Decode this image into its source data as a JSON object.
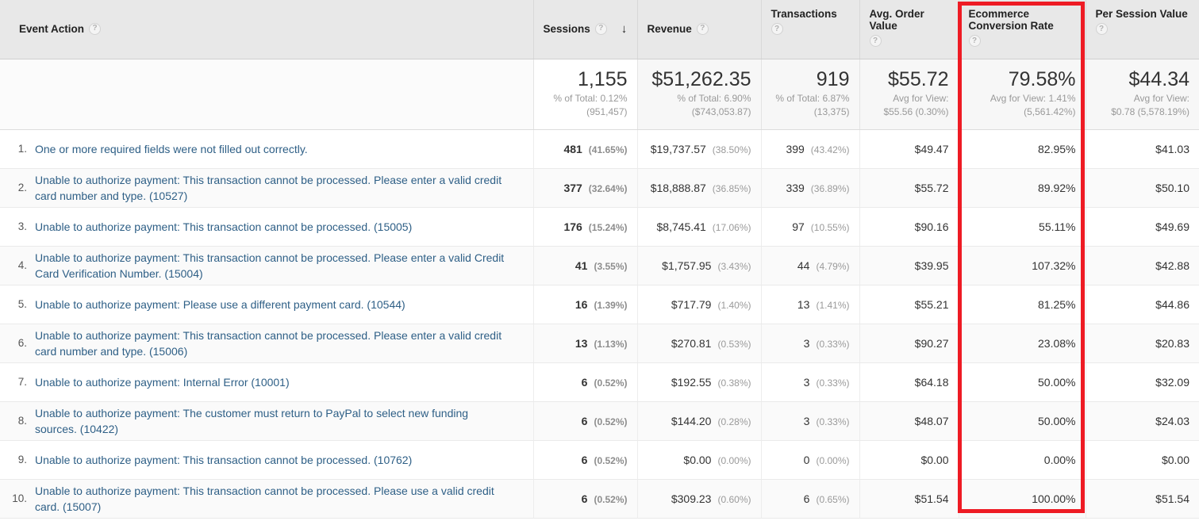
{
  "table": {
    "columns": [
      {
        "id": "event_action",
        "label": "Event Action",
        "help": "?",
        "align": "left",
        "sorted": false
      },
      {
        "id": "sessions",
        "label": "Sessions",
        "help": "?",
        "align": "right",
        "sorted": true,
        "sort_arrow": "↓"
      },
      {
        "id": "revenue",
        "label": "Revenue",
        "help": "?",
        "align": "right",
        "sorted": false
      },
      {
        "id": "transactions",
        "label": "Transactions",
        "help": "?",
        "align": "right",
        "sorted": false
      },
      {
        "id": "avg_order_value",
        "label": "Avg. Order Value",
        "help": "?",
        "align": "right",
        "sorted": false
      },
      {
        "id": "ecommerce_conversion_rate",
        "label": "Ecommerce Conversion Rate",
        "help": "?",
        "align": "right",
        "sorted": false,
        "highlighted": true
      },
      {
        "id": "per_session_value",
        "label": "Per Session Value",
        "help": "?",
        "align": "right",
        "sorted": false
      }
    ],
    "summary": {
      "sessions": {
        "value": "1,155",
        "line1": "% of Total: 0.12%",
        "line2": "(951,457)"
      },
      "revenue": {
        "value": "$51,262.35",
        "line1": "% of Total: 6.90%",
        "line2": "($743,053.87)"
      },
      "transactions": {
        "value": "919",
        "line1": "% of Total: 6.87%",
        "line2": "(13,375)"
      },
      "avg_order": {
        "value": "$55.72",
        "line1": "Avg for View:",
        "line2": "$55.56 (0.30%)"
      },
      "ecr": {
        "value": "79.58%",
        "line1": "Avg for View: 1.41%",
        "line2": "(5,561.42%)"
      },
      "psv": {
        "value": "$44.34",
        "line1": "Avg for View:",
        "line2": "$0.78 (5,578.19%)"
      }
    },
    "rows": [
      {
        "index": "1.",
        "label": "One or more required fields were not filled out correctly.",
        "lines": 1,
        "sessions": "481",
        "sessions_pct": "(41.65%)",
        "revenue": "$19,737.57",
        "revenue_pct": "(38.50%)",
        "transactions": "399",
        "transactions_pct": "(43.42%)",
        "avg_order": "$49.47",
        "ecr": "82.95%",
        "psv": "$41.03"
      },
      {
        "index": "2.",
        "label": "Unable to authorize payment: This transaction cannot be processed. Please enter a valid credit card number and type. (10527)",
        "lines": 2,
        "sessions": "377",
        "sessions_pct": "(32.64%)",
        "revenue": "$18,888.87",
        "revenue_pct": "(36.85%)",
        "transactions": "339",
        "transactions_pct": "(36.89%)",
        "avg_order": "$55.72",
        "ecr": "89.92%",
        "psv": "$50.10"
      },
      {
        "index": "3.",
        "label": "Unable to authorize payment: This transaction cannot be processed. (15005)",
        "lines": 1,
        "sessions": "176",
        "sessions_pct": "(15.24%)",
        "revenue": "$8,745.41",
        "revenue_pct": "(17.06%)",
        "transactions": "97",
        "transactions_pct": "(10.55%)",
        "avg_order": "$90.16",
        "ecr": "55.11%",
        "psv": "$49.69"
      },
      {
        "index": "4.",
        "label": "Unable to authorize payment: This transaction cannot be processed. Please enter a valid Credit Card Verification Number. (15004)",
        "lines": 2,
        "sessions": "41",
        "sessions_pct": "(3.55%)",
        "revenue": "$1,757.95",
        "revenue_pct": "(3.43%)",
        "transactions": "44",
        "transactions_pct": "(4.79%)",
        "avg_order": "$39.95",
        "ecr": "107.32%",
        "psv": "$42.88"
      },
      {
        "index": "5.",
        "label": "Unable to authorize payment: Please use a different payment card. (10544)",
        "lines": 1,
        "sessions": "16",
        "sessions_pct": "(1.39%)",
        "revenue": "$717.79",
        "revenue_pct": "(1.40%)",
        "transactions": "13",
        "transactions_pct": "(1.41%)",
        "avg_order": "$55.21",
        "ecr": "81.25%",
        "psv": "$44.86"
      },
      {
        "index": "6.",
        "label": "Unable to authorize payment: This transaction cannot be processed. Please enter a valid credit card number and type. (15006)",
        "lines": 2,
        "sessions": "13",
        "sessions_pct": "(1.13%)",
        "revenue": "$270.81",
        "revenue_pct": "(0.53%)",
        "transactions": "3",
        "transactions_pct": "(0.33%)",
        "avg_order": "$90.27",
        "ecr": "23.08%",
        "psv": "$20.83"
      },
      {
        "index": "7.",
        "label": "Unable to authorize payment: Internal Error (10001)",
        "lines": 1,
        "sessions": "6",
        "sessions_pct": "(0.52%)",
        "revenue": "$192.55",
        "revenue_pct": "(0.38%)",
        "transactions": "3",
        "transactions_pct": "(0.33%)",
        "avg_order": "$64.18",
        "ecr": "50.00%",
        "psv": "$32.09"
      },
      {
        "index": "8.",
        "label": "Unable to authorize payment: The customer must return to PayPal to select new funding sources. (10422)",
        "lines": 2,
        "sessions": "6",
        "sessions_pct": "(0.52%)",
        "revenue": "$144.20",
        "revenue_pct": "(0.28%)",
        "transactions": "3",
        "transactions_pct": "(0.33%)",
        "avg_order": "$48.07",
        "ecr": "50.00%",
        "psv": "$24.03"
      },
      {
        "index": "9.",
        "label": "Unable to authorize payment: This transaction cannot be processed. (10762)",
        "lines": 1,
        "sessions": "6",
        "sessions_pct": "(0.52%)",
        "revenue": "$0.00",
        "revenue_pct": "(0.00%)",
        "transactions": "0",
        "transactions_pct": "(0.00%)",
        "avg_order": "$0.00",
        "ecr": "0.00%",
        "psv": "$0.00"
      },
      {
        "index": "10.",
        "label": "Unable to authorize payment: This transaction cannot be processed. Please use a valid credit card. (15007)",
        "lines": 2,
        "sessions": "6",
        "sessions_pct": "(0.52%)",
        "revenue": "$309.23",
        "revenue_pct": "(0.60%)",
        "transactions": "6",
        "transactions_pct": "(0.65%)",
        "avg_order": "$51.54",
        "ecr": "100.00%",
        "psv": "$51.54"
      }
    ]
  },
  "annotation": {
    "highlight_color": "#ee1b24",
    "highlight_column": "Ecommerce Conversion Rate"
  },
  "colors": {
    "link": "#2e5f86",
    "header_bg": "#e8e8e8",
    "summary_bg": "#f7f7f7",
    "muted_text": "#9a9a9a"
  }
}
